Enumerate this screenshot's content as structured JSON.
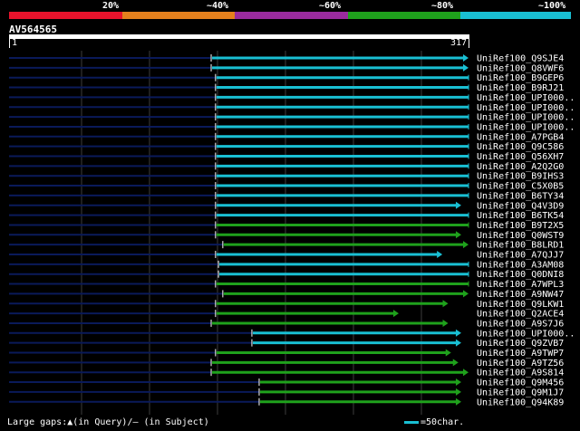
{
  "legend": {
    "labels": [
      "20%",
      "~40%",
      "~60%",
      "~80%",
      "~100%"
    ],
    "colors": [
      "#e8132c",
      "#e5801d",
      "#9a2b9e",
      "#1fa11c",
      "#19bfd3"
    ]
  },
  "query": {
    "id": "AV564565",
    "start_label": "1",
    "end_label": "317",
    "length": 317
  },
  "hits": [
    {
      "name": "UniRef100_Q9SJE4",
      "start": 140,
      "end": 317,
      "color": "#19bfd3",
      "arrow": true
    },
    {
      "name": "UniRef100_Q8VWF6",
      "start": 140,
      "end": 317,
      "color": "#19bfd3",
      "arrow": true
    },
    {
      "name": "UniRef100_B9GEP6",
      "start": 143,
      "end": 317,
      "color": "#19bfd3",
      "arrow": false
    },
    {
      "name": "UniRef100_B9RJ21",
      "start": 143,
      "end": 317,
      "color": "#19bfd3",
      "arrow": false
    },
    {
      "name": "UniRef100_UPI000..",
      "start": 143,
      "end": 317,
      "color": "#19bfd3",
      "arrow": false
    },
    {
      "name": "UniRef100_UPI000..",
      "start": 143,
      "end": 317,
      "color": "#19bfd3",
      "arrow": false
    },
    {
      "name": "UniRef100_UPI000..",
      "start": 143,
      "end": 317,
      "color": "#19bfd3",
      "arrow": false
    },
    {
      "name": "UniRef100_UPI000..",
      "start": 143,
      "end": 317,
      "color": "#19bfd3",
      "arrow": false
    },
    {
      "name": "UniRef100_A7PGB4",
      "start": 143,
      "end": 317,
      "color": "#19bfd3",
      "arrow": false
    },
    {
      "name": "UniRef100_Q9C586",
      "start": 143,
      "end": 317,
      "color": "#19bfd3",
      "arrow": false
    },
    {
      "name": "UniRef100_Q56XH7",
      "start": 143,
      "end": 317,
      "color": "#19bfd3",
      "arrow": false
    },
    {
      "name": "UniRef100_A2Q2G0",
      "start": 143,
      "end": 317,
      "color": "#19bfd3",
      "arrow": false
    },
    {
      "name": "UniRef100_B9IHS3",
      "start": 143,
      "end": 317,
      "color": "#19bfd3",
      "arrow": false
    },
    {
      "name": "UniRef100_C5X0B5",
      "start": 143,
      "end": 317,
      "color": "#19bfd3",
      "arrow": false
    },
    {
      "name": "UniRef100_B6TY34",
      "start": 143,
      "end": 317,
      "color": "#19bfd3",
      "arrow": false
    },
    {
      "name": "UniRef100_Q4V3D9",
      "start": 143,
      "end": 312,
      "color": "#19bfd3",
      "arrow": true
    },
    {
      "name": "UniRef100_B6TK54",
      "start": 143,
      "end": 317,
      "color": "#19bfd3",
      "arrow": false
    },
    {
      "name": "UniRef100_B9T2X5",
      "start": 143,
      "end": 317,
      "color": "#1fa11c",
      "arrow": false
    },
    {
      "name": "UniRef100_Q0WST9",
      "start": 143,
      "end": 312,
      "color": "#1fa11c",
      "arrow": true
    },
    {
      "name": "UniRef100_B8LRD1",
      "start": 148,
      "end": 317,
      "color": "#1fa11c",
      "arrow": true
    },
    {
      "name": "UniRef100_A7QJJ7",
      "start": 143,
      "end": 299,
      "color": "#19bfd3",
      "arrow": true
    },
    {
      "name": "UniRef100_A3AM08",
      "start": 145,
      "end": 317,
      "color": "#19bfd3",
      "arrow": false
    },
    {
      "name": "UniRef100_Q0DNI8",
      "start": 145,
      "end": 317,
      "color": "#19bfd3",
      "arrow": false
    },
    {
      "name": "UniRef100_A7WPL3",
      "start": 143,
      "end": 317,
      "color": "#1fa11c",
      "arrow": false
    },
    {
      "name": "UniRef100_A9NW47",
      "start": 148,
      "end": 317,
      "color": "#1fa11c",
      "arrow": true
    },
    {
      "name": "UniRef100_Q9LKW1",
      "start": 143,
      "end": 303,
      "color": "#1fa11c",
      "arrow": true
    },
    {
      "name": "UniRef100_Q2ACE4",
      "start": 143,
      "end": 269,
      "color": "#1fa11c",
      "arrow": true
    },
    {
      "name": "UniRef100_A9S7J6",
      "start": 140,
      "end": 303,
      "color": "#1fa11c",
      "arrow": true
    },
    {
      "name": "UniRef100_UPI000..",
      "start": 168,
      "end": 312,
      "color": "#19bfd3",
      "arrow": true
    },
    {
      "name": "UniRef100_Q9ZVB7",
      "start": 168,
      "end": 312,
      "color": "#19bfd3",
      "arrow": true
    },
    {
      "name": "UniRef100_A9TWP7",
      "start": 143,
      "end": 305,
      "color": "#1fa11c",
      "arrow": true
    },
    {
      "name": "UniRef100_A9TZ56",
      "start": 140,
      "end": 310,
      "color": "#1fa11c",
      "arrow": true
    },
    {
      "name": "UniRef100_A9S814",
      "start": 140,
      "end": 317,
      "color": "#1fa11c",
      "arrow": true
    },
    {
      "name": "UniRef100_Q9M456",
      "start": 173,
      "end": 312,
      "color": "#1fa11c",
      "arrow": true
    },
    {
      "name": "UniRef100_Q9M1J7",
      "start": 173,
      "end": 312,
      "color": "#1fa11c",
      "arrow": true
    },
    {
      "name": "UniRef100_Q94K89",
      "start": 173,
      "end": 312,
      "color": "#1fa11c",
      "arrow": true
    }
  ],
  "footer": {
    "gaps_text": "Large gaps:▲(in Query)/– (in Subject)",
    "scale_text": "=50char."
  }
}
